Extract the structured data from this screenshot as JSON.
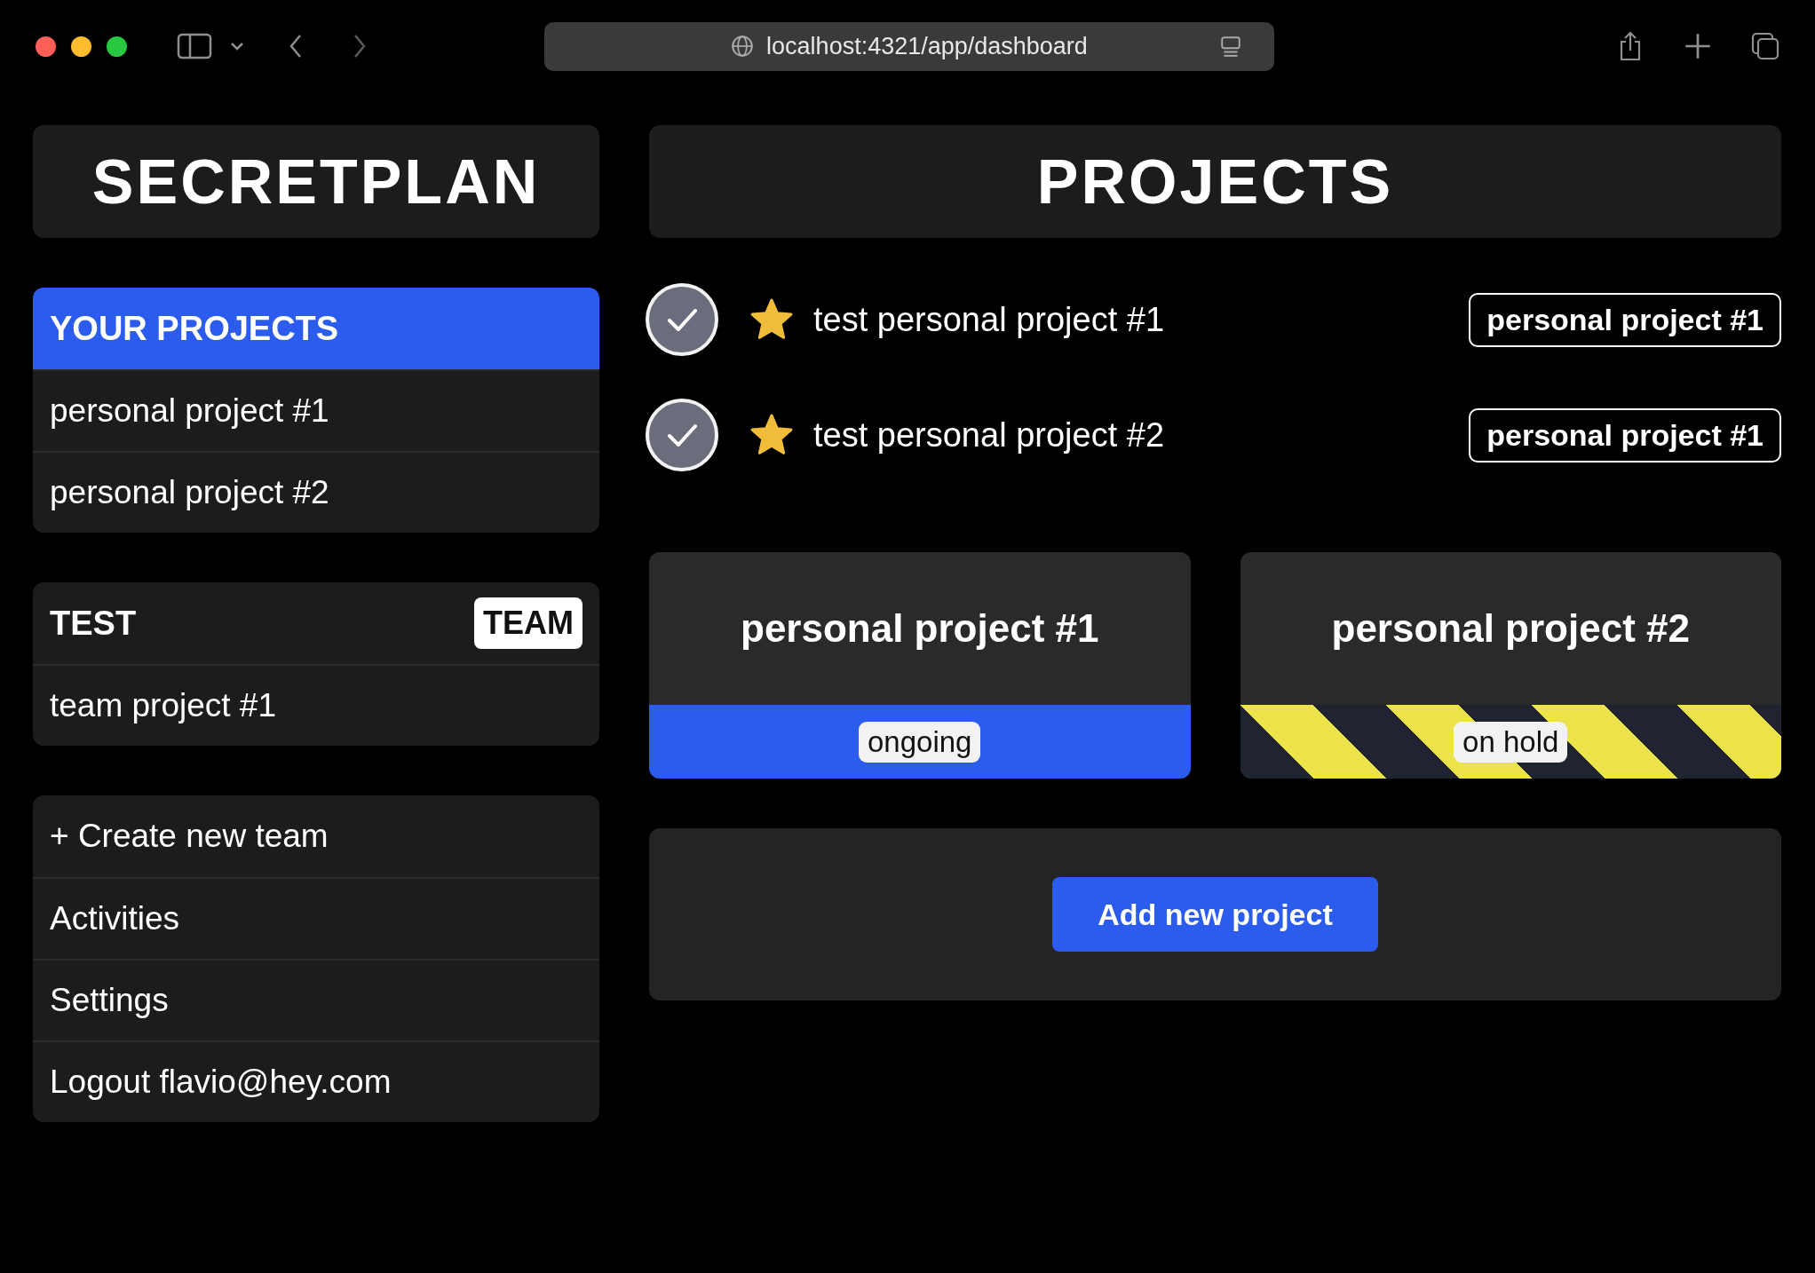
{
  "browser": {
    "url": "localhost:4321/app/dashboard"
  },
  "sidebar": {
    "title": "SECRETPLAN",
    "personal": {
      "heading": "YOUR PROJECTS",
      "selected": true,
      "items": [
        "personal project #1",
        "personal project #2"
      ]
    },
    "teams": [
      {
        "name": "TEST",
        "badge": "TEAM",
        "items": [
          "team project #1"
        ]
      }
    ],
    "menu": [
      "+ Create new team",
      "Activities",
      "Settings",
      "Logout flavio@hey.com"
    ]
  },
  "main": {
    "title": "PROJECTS",
    "tasks": [
      {
        "name": "test personal project #1",
        "done": true,
        "starred": true,
        "project": "personal project #1"
      },
      {
        "name": "test personal project #2",
        "done": true,
        "starred": true,
        "project": "personal project #1"
      }
    ],
    "projects": [
      {
        "name": "personal project #1",
        "status": "ongoing",
        "kind": "ongoing"
      },
      {
        "name": "personal project #2",
        "status": "on hold",
        "kind": "on_hold"
      }
    ],
    "add_button": "Add new project"
  }
}
